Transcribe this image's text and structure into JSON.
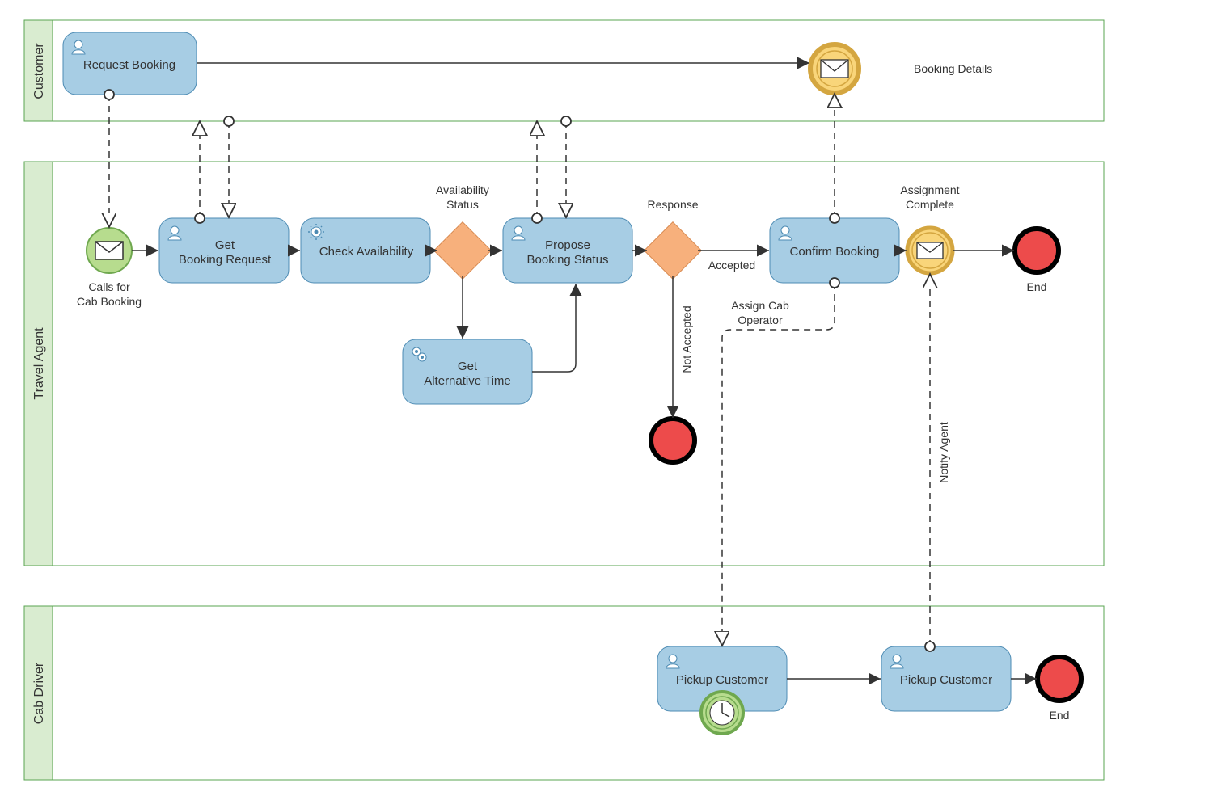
{
  "lanes": {
    "customer": "Customer",
    "agent": "Travel Agent",
    "driver": "Cab Driver"
  },
  "tasks": {
    "requestBooking": "Request Booking",
    "getBookingRequest": "Get\nBooking Request",
    "checkAvailability": "Check Availability",
    "getAlternativeTime": "Get\nAlternative Time",
    "proposeBookingStatus": "Propose\nBooking Status",
    "confirmBooking": "Confirm Booking",
    "pickupCustomer1": "Pickup Customer",
    "pickupCustomer2": "Pickup Customer"
  },
  "events": {
    "callsForCabBooking": "Calls for\nCab Booking",
    "bookingDetails": "Booking Details",
    "assignmentComplete": "Assignment\nComplete",
    "end1": "End",
    "end2": "End"
  },
  "gateways": {
    "availabilityStatus": "Availability\nStatus",
    "response": "Response"
  },
  "flows": {
    "accepted": "Accepted",
    "notAccepted": "Not Accepted",
    "assignCabOperator": "Assign Cab\nOperator",
    "notifyAgent": "Notify Agent"
  },
  "colors": {
    "laneFill": "#d9ecd0",
    "laneBorder": "#5aa552",
    "taskFill": "#a7cde4",
    "taskBorder": "#4d8bb3",
    "gatewayFill": "#f7b07c",
    "gatewayBorder": "#d88a52",
    "startFill": "#b7dc8e",
    "startBorder": "#6fa84f",
    "msgFill": "#f9d57a",
    "msgBorder": "#d4a640",
    "endFill": "#ed4b4b",
    "endBorder": "#000"
  }
}
